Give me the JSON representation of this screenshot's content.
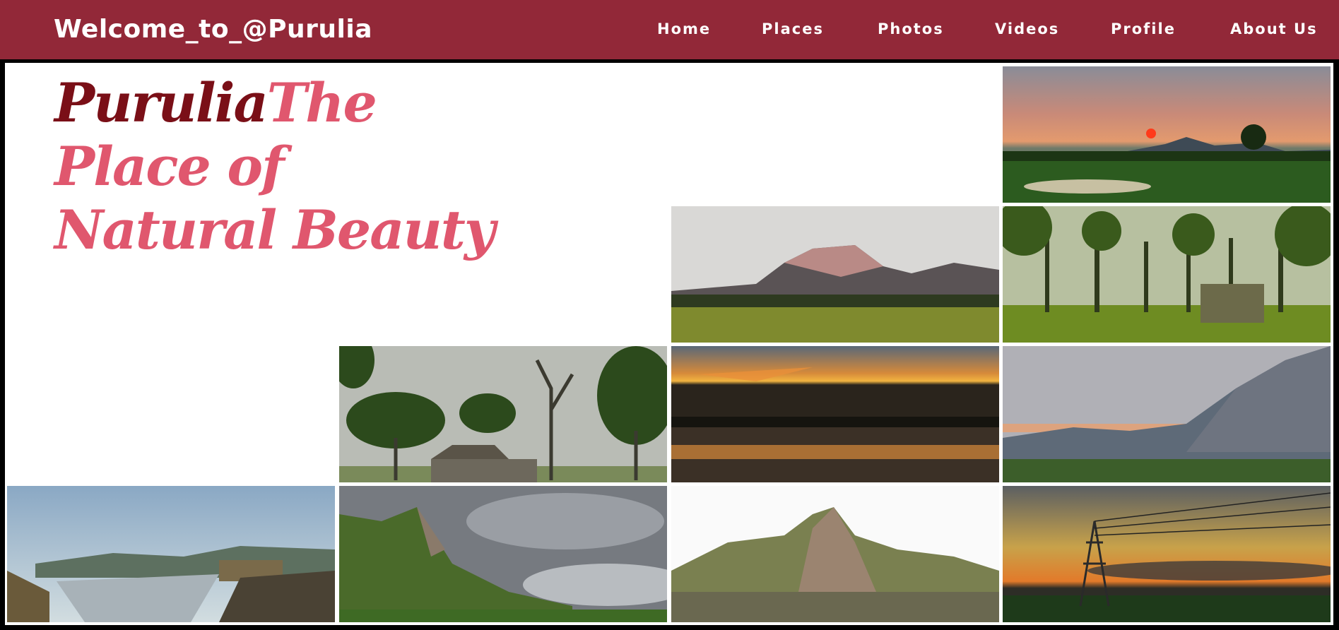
{
  "header": {
    "brand": "Welcome_to_@Purulia",
    "nav": [
      "Home",
      "Places",
      "Photos",
      "Videos",
      "Profile",
      "About Us"
    ]
  },
  "hero": {
    "title_part1": "Purulia",
    "title_part2": "The Place of Natural Beauty"
  },
  "gallery": [
    {
      "name": "sunset-over-field-photo"
    },
    {
      "name": "rocky-hill-field-photo"
    },
    {
      "name": "forest-ruin-photo"
    },
    {
      "name": "trees-old-house-photo"
    },
    {
      "name": "lake-sunset-photo"
    },
    {
      "name": "hill-valley-dusk-photo"
    },
    {
      "name": "dam-waterfall-photo"
    },
    {
      "name": "green-hill-clouds-photo"
    },
    {
      "name": "rock-outcrop-photo"
    },
    {
      "name": "power-tower-sunset-photo"
    }
  ],
  "colors": {
    "navbar": "#922838",
    "brand_text": "#ffffff",
    "hero_dark": "#7a0f17",
    "hero_light": "#e0576e"
  }
}
